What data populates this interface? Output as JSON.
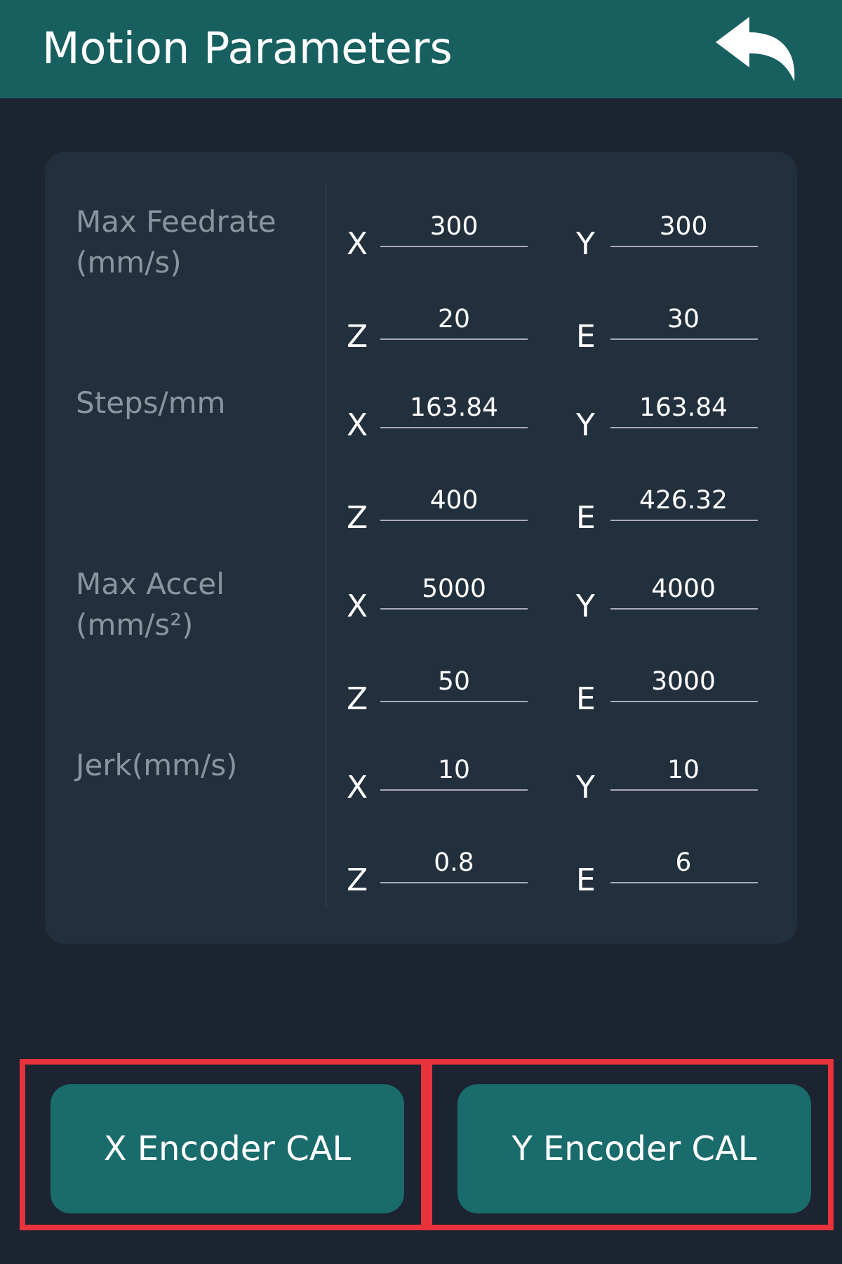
{
  "header": {
    "title": "Motion Parameters"
  },
  "groups": [
    {
      "label": "Max Feedrate\n(mm/s)",
      "fields": [
        {
          "axis": "X",
          "value": "300"
        },
        {
          "axis": "Y",
          "value": "300"
        },
        {
          "axis": "Z",
          "value": "20"
        },
        {
          "axis": "E",
          "value": "30"
        }
      ]
    },
    {
      "label": "Steps/mm",
      "fields": [
        {
          "axis": "X",
          "value": "163.84"
        },
        {
          "axis": "Y",
          "value": "163.84"
        },
        {
          "axis": "Z",
          "value": "400"
        },
        {
          "axis": "E",
          "value": "426.32"
        }
      ]
    },
    {
      "label": "Max Accel\n(mm/s²)",
      "fields": [
        {
          "axis": "X",
          "value": "5000"
        },
        {
          "axis": "Y",
          "value": "4000"
        },
        {
          "axis": "Z",
          "value": "50"
        },
        {
          "axis": "E",
          "value": "3000"
        }
      ]
    },
    {
      "label": "Jerk(mm/s)",
      "fields": [
        {
          "axis": "X",
          "value": "10"
        },
        {
          "axis": "Y",
          "value": "10"
        },
        {
          "axis": "Z",
          "value": "0.8"
        },
        {
          "axis": "E",
          "value": "6"
        }
      ]
    }
  ],
  "buttons": [
    {
      "label": "X Encoder CAL",
      "highlighted": true
    },
    {
      "label": "Y Encoder CAL",
      "highlighted": true
    }
  ]
}
